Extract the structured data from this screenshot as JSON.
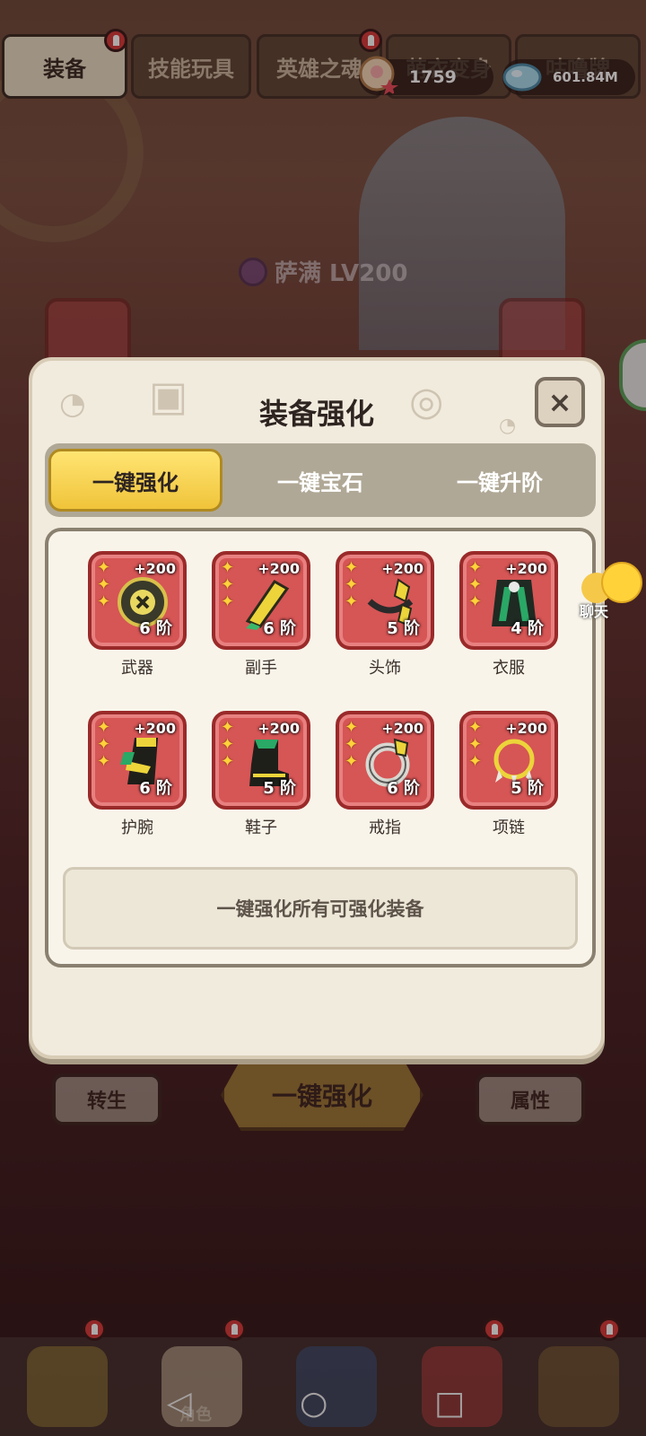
{
  "top_tabs": [
    {
      "label": "装备",
      "active": true
    },
    {
      "label": "技能玩具",
      "active": false
    },
    {
      "label": "英雄之魂",
      "active": false
    },
    {
      "label": "萌衣变身",
      "active": false
    },
    {
      "label": "咕噜牌",
      "active": false
    }
  ],
  "currency": {
    "shell": {
      "value": "1759",
      "icon": "shell-icon"
    },
    "gem": {
      "value": "601.84M",
      "icon": "gem-icon"
    }
  },
  "hero": {
    "label": "萨满 LV200"
  },
  "modal": {
    "title": "装备强化",
    "close_label": "×",
    "tabs": [
      "一键强化",
      "一键宝石",
      "一键升阶"
    ],
    "active_tab": 0,
    "items": [
      {
        "name": "武器",
        "plus": "+200",
        "grade": "6 阶",
        "stars": 3,
        "icon": "shield-gear-icon"
      },
      {
        "name": "副手",
        "plus": "+200",
        "grade": "6 阶",
        "stars": 3,
        "icon": "blade-gear-icon"
      },
      {
        "name": "头饰",
        "plus": "+200",
        "grade": "5 阶",
        "stars": 3,
        "icon": "headband-gear-icon"
      },
      {
        "name": "衣服",
        "plus": "+200",
        "grade": "4 阶",
        "stars": 3,
        "icon": "robe-gear-icon"
      },
      {
        "name": "护腕",
        "plus": "+200",
        "grade": "6 阶",
        "stars": 3,
        "icon": "bracer-gear-icon"
      },
      {
        "name": "鞋子",
        "plus": "+200",
        "grade": "5 阶",
        "stars": 3,
        "icon": "boots-gear-icon"
      },
      {
        "name": "戒指",
        "plus": "+200",
        "grade": "6 阶",
        "stars": 3,
        "icon": "ring-gear-icon"
      },
      {
        "name": "项链",
        "plus": "+200",
        "grade": "5 阶",
        "stars": 3,
        "icon": "necklace-gear-icon"
      }
    ],
    "hint": "一键强化所有可强化装备"
  },
  "background_buttons": {
    "left": "转生",
    "center": "一键强化",
    "right": "属性"
  },
  "chat": {
    "label": "聊天"
  },
  "bottom_nav": {
    "active_label": "角色"
  },
  "colors": {
    "slot_red": "#d65555",
    "active_tab_yellow": "#f0c43a",
    "modal_bg": "#f1ebde"
  }
}
